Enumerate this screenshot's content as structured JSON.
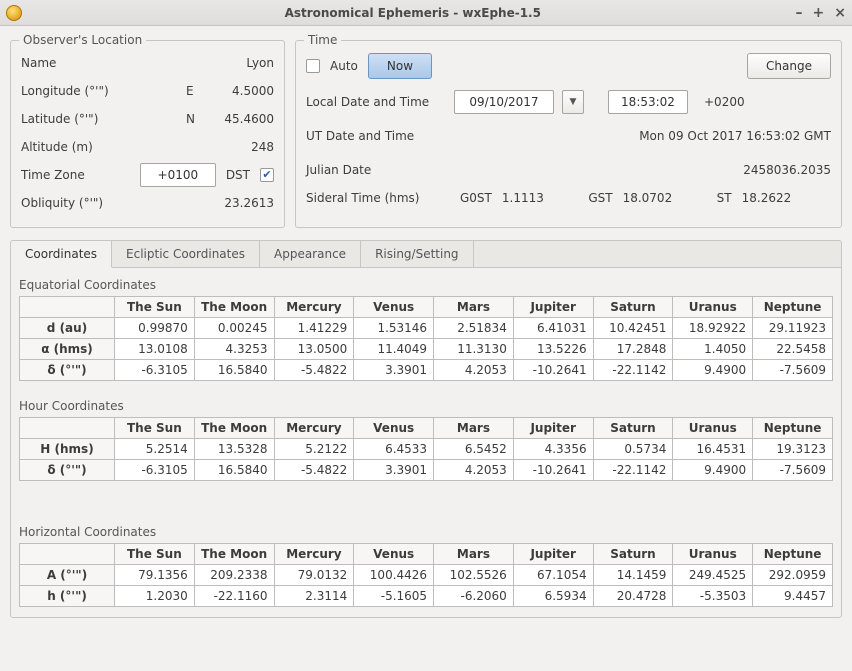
{
  "window": {
    "title": "Astronomical Ephemeris - wxEphe-1.5"
  },
  "observer": {
    "legend": "Observer's Location",
    "rows": {
      "name": {
        "label": "Name",
        "pre": "",
        "value": "Lyon"
      },
      "lon": {
        "label": "Longitude (°'\")",
        "pre": "E",
        "value": "4.5000"
      },
      "lat": {
        "label": "Latitude (°'\")",
        "pre": "N",
        "value": "45.4600"
      },
      "alt": {
        "label": "Altitude (m)",
        "pre": "",
        "value": "248"
      }
    },
    "tz": {
      "label": "Time Zone",
      "value": "+0100",
      "dst_label": "DST",
      "dst_checked": true
    },
    "obl": {
      "label": "Obliquity (°'\")",
      "value": "23.2613"
    }
  },
  "time": {
    "legend": "Time",
    "auto_label": "Auto",
    "auto_checked": false,
    "now_label": "Now",
    "change_label": "Change",
    "local_label": "Local Date and Time",
    "local_date": "09/10/2017",
    "local_time": "18:53:02",
    "local_offset": "+0200",
    "ut_label": "UT Date and Time",
    "ut_value": "Mon 09 Oct 2017 16:53:02 GMT",
    "jd_label": "Julian Date",
    "jd_value": "2458036.2035",
    "sid_label": "Sideral Time (hms)",
    "sid": {
      "g0st": "1.1113",
      "gst": "18.0702",
      "st": "18.2622"
    }
  },
  "tabs": {
    "coordinates": "Coordinates",
    "ecliptic": "Ecliptic Coordinates",
    "appearance": "Appearance",
    "rising": "Rising/Setting"
  },
  "bodies": [
    "The Sun",
    "The Moon",
    "Mercury",
    "Venus",
    "Mars",
    "Jupiter",
    "Saturn",
    "Uranus",
    "Neptune"
  ],
  "sections": {
    "eq": {
      "title": "Equatorial Coordinates",
      "rows": [
        {
          "label": "d (au)",
          "vals": [
            "0.99870",
            "0.00245",
            "1.41229",
            "1.53146",
            "2.51834",
            "6.41031",
            "10.42451",
            "18.92922",
            "29.11923"
          ]
        },
        {
          "label": "α (hms)",
          "vals": [
            "13.0108",
            "4.3253",
            "13.0500",
            "11.4049",
            "11.3130",
            "13.5226",
            "17.2848",
            "1.4050",
            "22.5458"
          ]
        },
        {
          "label": "δ (°'\")",
          "vals": [
            "-6.3105",
            "16.5840",
            "-5.4822",
            "3.3901",
            "4.2053",
            "-10.2641",
            "-22.1142",
            "9.4900",
            "-7.5609"
          ]
        }
      ]
    },
    "hour": {
      "title": "Hour Coordinates",
      "rows": [
        {
          "label": "H (hms)",
          "vals": [
            "5.2514",
            "13.5328",
            "5.2122",
            "6.4533",
            "6.5452",
            "4.3356",
            "0.5734",
            "16.4531",
            "19.3123"
          ]
        },
        {
          "label": "δ (°'\")",
          "vals": [
            "-6.3105",
            "16.5840",
            "-5.4822",
            "3.3901",
            "4.2053",
            "-10.2641",
            "-22.1142",
            "9.4900",
            "-7.5609"
          ]
        }
      ]
    },
    "hor": {
      "title": "Horizontal Coordinates",
      "rows": [
        {
          "label": "A (°'\")",
          "vals": [
            "79.1356",
            "209.2338",
            "79.0132",
            "100.4426",
            "102.5526",
            "67.1054",
            "14.1459",
            "249.4525",
            "292.0959"
          ]
        },
        {
          "label": "h (°'\")",
          "vals": [
            "1.2030",
            "-22.1160",
            "2.3114",
            "-5.1605",
            "-6.2060",
            "6.5934",
            "20.4728",
            "-5.3503",
            "9.4457"
          ]
        }
      ]
    }
  }
}
